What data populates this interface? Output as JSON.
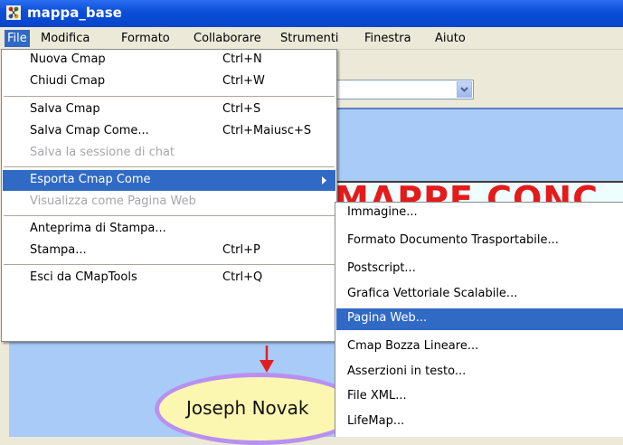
{
  "window": {
    "title": "mappa_base"
  },
  "menubar": {
    "items": [
      {
        "label": "File",
        "active": true
      },
      {
        "label": "Modifica"
      },
      {
        "label": "Formato"
      },
      {
        "label": "Collaborare"
      },
      {
        "label": "Strumenti"
      },
      {
        "label": "Finestra"
      },
      {
        "label": "Aiuto"
      }
    ]
  },
  "file_menu": {
    "items": [
      {
        "label": "Nuova Cmap",
        "shortcut": "Ctrl+N"
      },
      {
        "label": "Chiudi Cmap",
        "shortcut": "Ctrl+W"
      },
      {
        "label": "Salva Cmap",
        "shortcut": "Ctrl+S"
      },
      {
        "label": "Salva Cmap Come...",
        "shortcut": "Ctrl+Maiusc+S"
      },
      {
        "label": "Salva la sessione di  chat",
        "disabled": true
      },
      {
        "label": "Esporta Cmap Come",
        "highlighted": true
      },
      {
        "label": "Visualizza come Pagina Web",
        "disabled": true
      },
      {
        "label": "Anteprima di Stampa..."
      },
      {
        "label": "Stampa...",
        "shortcut": "Ctrl+P"
      },
      {
        "label": "Esci da CMapTools",
        "shortcut": "Ctrl+Q"
      }
    ]
  },
  "export_submenu": {
    "items": [
      {
        "label": "Immagine..."
      },
      {
        "label": "Formato Documento Trasportabile..."
      },
      {
        "label": "Postscript..."
      },
      {
        "label": "Grafica Vettoriale Scalabile..."
      },
      {
        "label": "Pagina Web...",
        "highlighted": true
      },
      {
        "label": "Cmap Bozza Lineare..."
      },
      {
        "label": "Asserzioni in testo..."
      },
      {
        "label": "File XML..."
      },
      {
        "label": "LifeMap..."
      }
    ]
  },
  "canvas": {
    "banner_text": "MAPPE CONC",
    "node_text": "Joseph Novak"
  },
  "colors": {
    "menu_highlight": "#316ac5",
    "titlebar": "#0a4ed8",
    "canvas": "#a9cbf7",
    "banner_text": "#e41b1b",
    "node_fill": "#fbf6b0",
    "node_border": "#b990f0"
  }
}
